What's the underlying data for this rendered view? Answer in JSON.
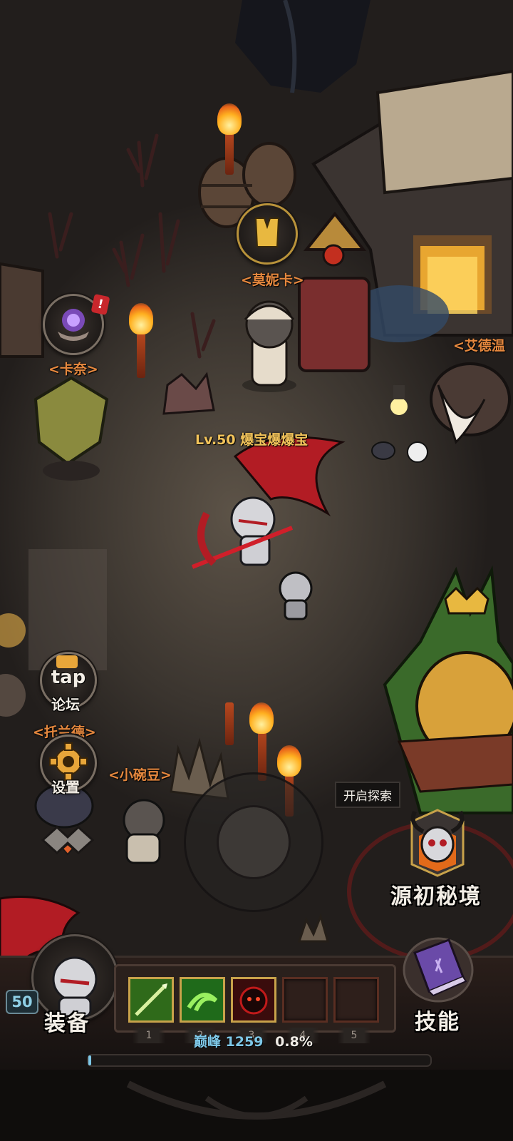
{
  "npcs": {
    "monica": "<莫妮卡>",
    "kana": "<卡奈>",
    "edward": "<艾德温",
    "tuolande": "<托兰德>",
    "xiaowandou": "<小碗豆>"
  },
  "player": {
    "name": "Lv.50 爆宝爆爆宝"
  },
  "side_buttons": {
    "forum_icon_text": "tap",
    "forum_label": "论坛",
    "settings_label": "设置"
  },
  "explore": {
    "tooltip": "开启探索",
    "label": "源初秘境"
  },
  "bottom_bar": {
    "level": "50",
    "equip_label": "装备",
    "skills_label": "技能",
    "slot_numbers": [
      "1",
      "2",
      "3",
      "4",
      "5"
    ],
    "peak_label": "巅峰",
    "peak_value": "1259",
    "peak_progress_text": "0.8%",
    "peak_progress": 0.008
  },
  "colors": {
    "npc_name": "#e6883e",
    "player_name": "#f2c35a",
    "peak_text": "#7ec8e8"
  },
  "icons": [
    "monica-robe-icon",
    "kana-crystal-ball-icon",
    "alert-icon",
    "tap-forum-icon",
    "gear-icon",
    "collapse-icon",
    "skull-portal-icon",
    "skill-book-icon",
    "player-avatar-icon",
    "joystick-icon"
  ]
}
